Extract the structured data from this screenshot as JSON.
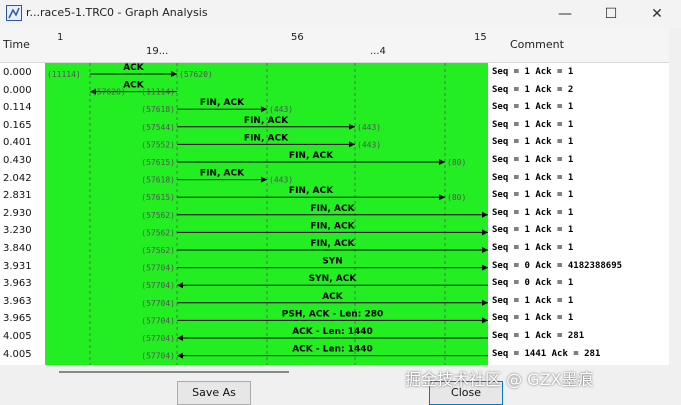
{
  "window": {
    "title": "r...race5-1.TRC0 - Graph Analysis",
    "min_label": "—",
    "max_label": "☐",
    "close_label": "✕"
  },
  "header": {
    "time_label": "Time",
    "comment_label": "Comment",
    "node_labels": [
      "1",
      "56",
      "15",
      "19...",
      "...4"
    ]
  },
  "rows": [
    {
      "time": "0.000",
      "label": "ACK",
      "src_port": "(11114)",
      "dst_port": "(57620)",
      "comment": "Seq = 1 Ack = 1"
    },
    {
      "time": "0.000",
      "label": "ACK",
      "src_port": "(11114)",
      "dst_port": "(57620)",
      "comment": "Seq = 1 Ack = 2"
    },
    {
      "time": "0.114",
      "label": "FIN, ACK",
      "src_port": "(57618)",
      "dst_port": "(443)",
      "comment": "Seq = 1 Ack = 1"
    },
    {
      "time": "0.165",
      "label": "FIN, ACK",
      "src_port": "(57544)",
      "dst_port": "(443)",
      "comment": "Seq = 1 Ack = 1"
    },
    {
      "time": "0.401",
      "label": "FIN, ACK",
      "src_port": "(57552)",
      "dst_port": "(443)",
      "comment": "Seq = 1 Ack = 1"
    },
    {
      "time": "0.430",
      "label": "FIN, ACK",
      "src_port": "(57615)",
      "dst_port": "(80)",
      "comment": "Seq = 1 Ack = 1"
    },
    {
      "time": "2.042",
      "label": "FIN, ACK",
      "src_port": "(57618)",
      "dst_port": "(443)",
      "comment": "Seq = 1 Ack = 1"
    },
    {
      "time": "2.831",
      "label": "FIN, ACK",
      "src_port": "(57615)",
      "dst_port": "(80)",
      "comment": "Seq = 1 Ack = 1"
    },
    {
      "time": "2.930",
      "label": "FIN, ACK",
      "src_port": "(57562)",
      "dst_port": "",
      "comment": "Seq = 1 Ack = 1"
    },
    {
      "time": "3.230",
      "label": "FIN, ACK",
      "src_port": "(57562)",
      "dst_port": "",
      "comment": "Seq = 1 Ack = 1"
    },
    {
      "time": "3.840",
      "label": "FIN, ACK",
      "src_port": "(57562)",
      "dst_port": "",
      "comment": "Seq = 1 Ack = 1"
    },
    {
      "time": "3.931",
      "label": "SYN",
      "src_port": "(57704)",
      "dst_port": "",
      "comment": "Seq = 0 Ack = 4182388695"
    },
    {
      "time": "3.963",
      "label": "SYN, ACK",
      "src_port": "(57704)",
      "dst_port": "",
      "comment": "Seq = 0 Ack = 1"
    },
    {
      "time": "3.963",
      "label": "ACK",
      "src_port": "(57704)",
      "dst_port": "",
      "comment": "Seq = 1 Ack = 1"
    },
    {
      "time": "3.965",
      "label": "PSH, ACK - Len: 280",
      "src_port": "(57704)",
      "dst_port": "",
      "comment": "Seq = 1 Ack = 1"
    },
    {
      "time": "4.005",
      "label": "ACK - Len: 1440",
      "src_port": "(57704)",
      "dst_port": "",
      "comment": "Seq = 1 Ack = 281"
    },
    {
      "time": "4.005",
      "label": "ACK - Len: 1440",
      "src_port": "(57704)",
      "dst_port": "",
      "comment": "Seq = 1441 Ack = 281"
    }
  ],
  "buttons": {
    "save_as": "Save As",
    "close": "Close"
  },
  "watermark": "掘金技术社区 @ GZX墨痕",
  "colors": {
    "graph_bg": "#22ee22",
    "arrow": "#000000",
    "port_text": "#555555"
  }
}
